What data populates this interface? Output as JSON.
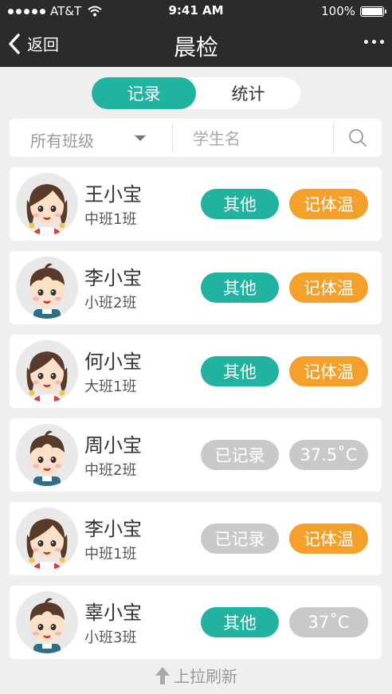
{
  "status": {
    "carrier": "AT&T",
    "time": "9:41 AM",
    "battery": "100%"
  },
  "nav": {
    "back_label": "返回",
    "title": "晨检"
  },
  "tabs": [
    {
      "label": "记录",
      "active": true
    },
    {
      "label": "统计",
      "active": false
    }
  ],
  "filter": {
    "class_select": "所有班级",
    "search_placeholder": "学生名"
  },
  "students": [
    {
      "name": "王小宝",
      "class": "中班1班",
      "left_label": "其他",
      "left_style": "teal",
      "right_label": "记体温",
      "right_style": "orange",
      "avatar": "girl-avatar"
    },
    {
      "name": "李小宝",
      "class": "小班2班",
      "left_label": "其他",
      "left_style": "teal",
      "right_label": "记体温",
      "right_style": "orange",
      "avatar": "boy-avatar"
    },
    {
      "name": "何小宝",
      "class": "大班1班",
      "left_label": "其他",
      "left_style": "teal",
      "right_label": "记体温",
      "right_style": "orange",
      "avatar": "girl-avatar"
    },
    {
      "name": "周小宝",
      "class": "中班2班",
      "left_label": "已记录",
      "left_style": "gray",
      "right_label": "37.5˚C",
      "right_style": "gray",
      "avatar": "boy-avatar"
    },
    {
      "name": "李小宝",
      "class": "中班1班",
      "left_label": "已记录",
      "left_style": "gray",
      "right_label": "记体温",
      "right_style": "orange",
      "avatar": "girl-avatar"
    },
    {
      "name": "辜小宝",
      "class": "小班3班",
      "left_label": "其他",
      "left_style": "teal",
      "right_label": "37˚C",
      "right_style": "gray",
      "avatar": "boy-avatar"
    }
  ],
  "footer": {
    "pull_refresh": "上拉刷新"
  },
  "colors": {
    "teal": "#22b3a0",
    "orange": "#f5a02a",
    "gray": "#c9c9c9",
    "nav_bg": "#2b2b2b"
  }
}
